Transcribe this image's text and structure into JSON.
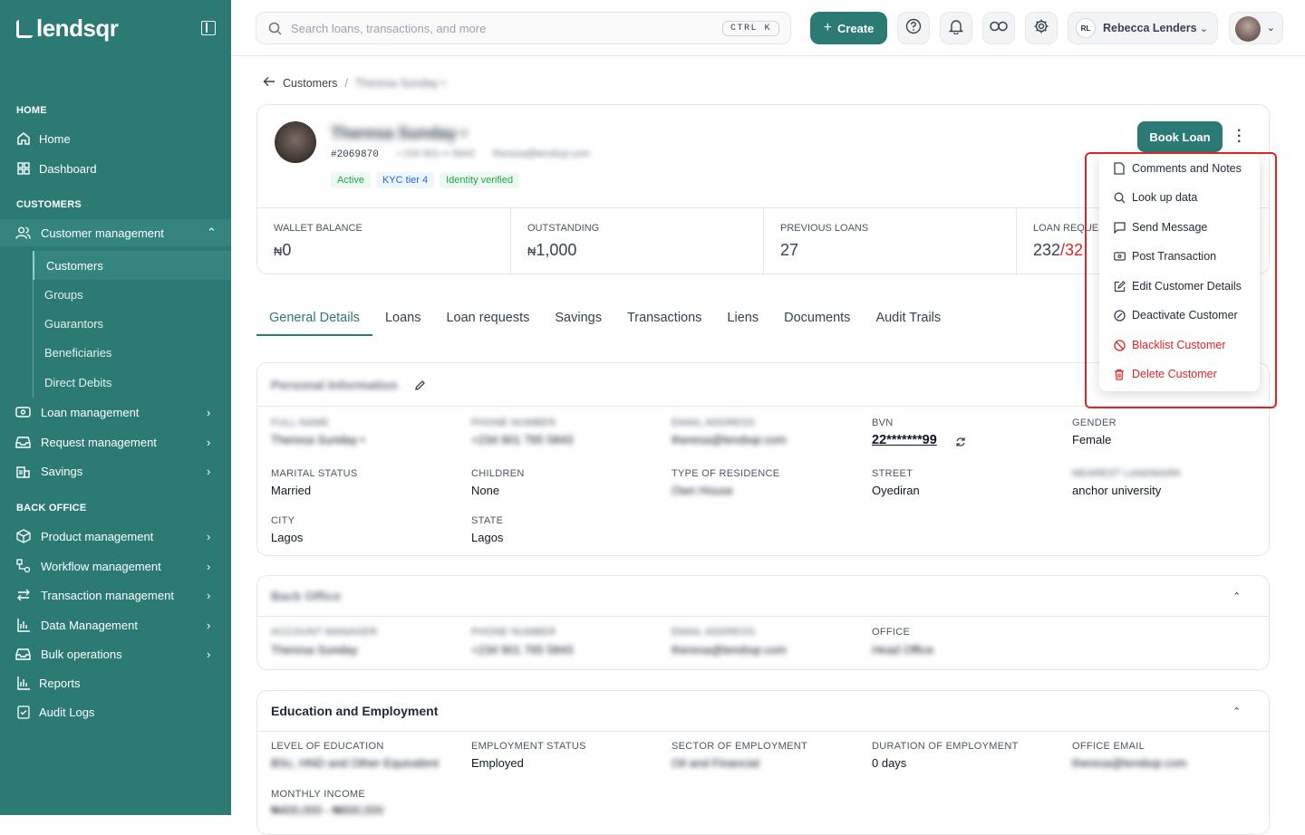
{
  "brand": "lendsqr",
  "sidebar": {
    "sections": {
      "home": "HOME",
      "customers": "CUSTOMERS",
      "back_office": "BACK OFFICE"
    },
    "home_items": [
      "Home",
      "Dashboard"
    ],
    "customer_mgmt": "Customer management",
    "customer_sub": [
      "Customers",
      "Groups",
      "Guarantors",
      "Beneficiaries",
      "Direct Debits"
    ],
    "customer_more": [
      "Loan management",
      "Request management",
      "Savings"
    ],
    "back_office_items": [
      "Product management",
      "Workflow management",
      "Transaction management",
      "Data Management",
      "Bulk operations",
      "Reports",
      "Audit Logs"
    ]
  },
  "topbar": {
    "search_placeholder": "Search loans, transactions, and more",
    "shortcut": "CTRL K",
    "create_label": "Create",
    "user_initials": "RL",
    "user_name": "Rebecca Lenders"
  },
  "breadcrumb": {
    "root": "Customers",
    "sep": "/",
    "current": "Theresa Sunday •"
  },
  "profile": {
    "name": "Theresa Sunday •",
    "id": "#2069870",
    "phone": "• 234 901 •• 5843",
    "email": "theresa@lendsqr.com",
    "badges": [
      "Active",
      "KYC tier 4",
      "Identity verified"
    ],
    "book_loan": "Book Loan"
  },
  "stats": [
    {
      "label": "WALLET BALANCE",
      "currency": "₦",
      "value": "0"
    },
    {
      "label": "OUTSTANDING",
      "currency": "₦",
      "value": "1,000"
    },
    {
      "label": "PREVIOUS LOANS",
      "currency": "",
      "value": "27"
    },
    {
      "label": "LOAN REQUESTS",
      "currency": "",
      "value": "232",
      "value_red": "/32"
    }
  ],
  "tabs": [
    "General Details",
    "Loans",
    "Loan requests",
    "Savings",
    "Transactions",
    "Liens",
    "Documents",
    "Audit Trails"
  ],
  "personal": {
    "title": "Personal Information",
    "fields": [
      {
        "label": "FULL NAME",
        "value": "Theresa Sunday •"
      },
      {
        "label": "PHONE NUMBER",
        "value": "+234 901 765 5843"
      },
      {
        "label": "EMAIL ADDRESS",
        "value": "theresa@lendsqr.com"
      },
      {
        "label": "BVN",
        "value": "22*******99"
      },
      {
        "label": "GENDER",
        "value": "Female"
      },
      {
        "label": "MARITAL STATUS",
        "value": "Married"
      },
      {
        "label": "CHILDREN",
        "value": "None"
      },
      {
        "label": "TYPE OF RESIDENCE",
        "value": "Own House"
      },
      {
        "label": "STREET",
        "value": "Oyediran"
      },
      {
        "label": "NEAREST LANDMARK",
        "value": "anchor university"
      },
      {
        "label": "CITY",
        "value": "Lagos"
      },
      {
        "label": "STATE",
        "value": "Lagos"
      }
    ]
  },
  "bank_office": {
    "title": "Back Office",
    "fields": [
      {
        "label": "ACCOUNT MANAGER",
        "value": "Theresa Sunday"
      },
      {
        "label": "PHONE NUMBER",
        "value": "+234 901 765 5843"
      },
      {
        "label": "EMAIL ADDRESS",
        "value": "theresa@lendsqr.com"
      },
      {
        "label": "OFFICE",
        "value": "Head Office"
      }
    ]
  },
  "education": {
    "title": "Education and Employment",
    "fields": [
      {
        "label": "LEVEL OF EDUCATION",
        "value": "BSc, HND and Other Equivalent"
      },
      {
        "label": "EMPLOYMENT STATUS",
        "value": "Employed"
      },
      {
        "label": "SECTOR OF EMPLOYMENT",
        "value": "Oil and Financial"
      },
      {
        "label": "DURATION OF EMPLOYMENT",
        "value": "0 days"
      },
      {
        "label": "OFFICE EMAIL",
        "value": "theresa@lendsqr.com"
      },
      {
        "label": "MONTHLY INCOME",
        "value": "₦400,000 - ₦600,000"
      }
    ]
  },
  "menu": [
    "Comments and Notes",
    "Look up data",
    "Send Message",
    "Post Transaction",
    "Edit Customer Details",
    "Deactivate Customer",
    "Blacklist Customer",
    "Delete Customer"
  ],
  "colors": {
    "primary": "#2b7a73",
    "danger": "#dc2626"
  }
}
